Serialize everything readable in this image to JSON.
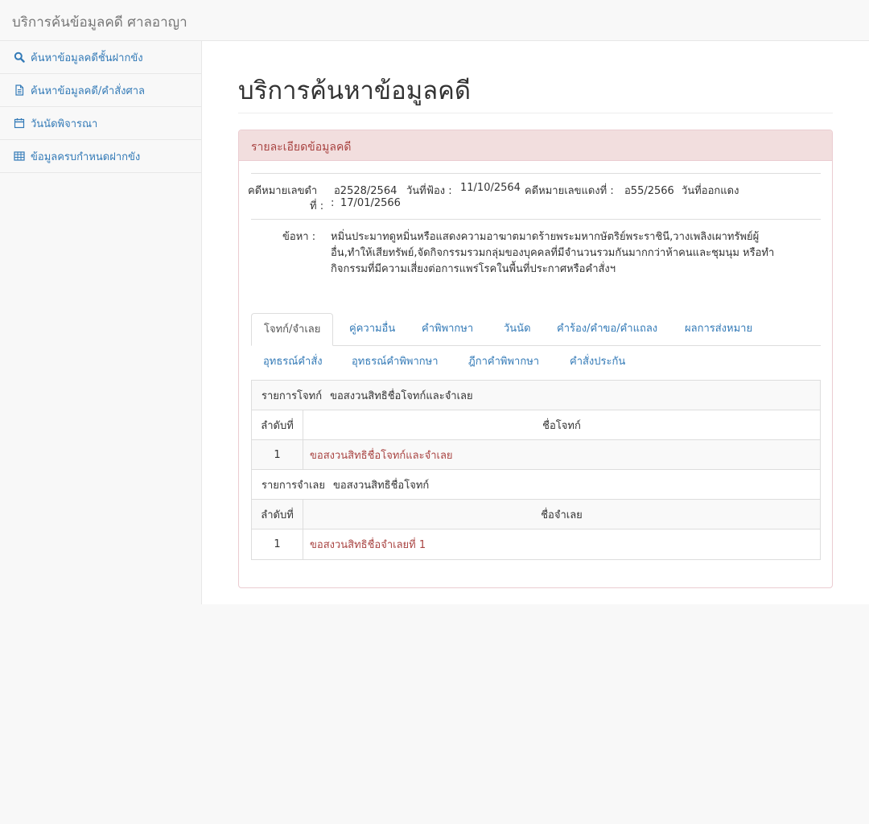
{
  "navbar": {
    "brand": "บริการค้นข้อมูลคดี ศาลอาญา"
  },
  "sidebar": {
    "items": [
      {
        "label": "ค้นหาข้อมูลคดีชั้นฝากขัง",
        "icon": "search-icon"
      },
      {
        "label": "ค้นหาข้อมูลคดี/คำสั่งศาล",
        "icon": "document-icon"
      },
      {
        "label": "วันนัดพิจารณา",
        "icon": "calendar-icon"
      },
      {
        "label": "ข้อมูลครบกำหนดฝากขัง",
        "icon": "table-icon"
      }
    ]
  },
  "main": {
    "title": "บริการค้นหาข้อมูลคดี"
  },
  "panel": {
    "heading": "รายละเอียดข้อมูลคดี",
    "black_case_label_1": "คดีหมายเลขดำ",
    "black_case_label_2": "ที่ :",
    "black_case_value": "อ2528/2564",
    "filed_label": "วันที่ฟ้อง :",
    "filed_value": "11/10/2564",
    "red_case_label": "คดีหมายเลขแดงที่ :",
    "red_case_value": "อ55/2566",
    "red_date_label": "วันที่ออกแดง",
    "red_date_colon": ":",
    "red_date_value": "17/01/2566",
    "charge_label": "ข้อหา :",
    "charge_line1": "หมิ่นประมาทดูหมิ่นหรือแสดงความอาฆาตมาดร้ายพระมหากษัตริย์พระราชินี,วางเพลิงเผาทรัพย์ผู้",
    "charge_line2": "อื่น,ทำให้เสียทรัพย์,จัดกิจกรรมรวมกลุ่มของบุคคลที่มีจำนวนรวมกันมากกว่าห้าคนและชุมนุม หรือทำ",
    "charge_line3": "กิจกรรมที่มีความเสี่ยงต่อการแพร่โรคในพื้นที่ประกาศหรือคำสั่งฯ"
  },
  "tabs": [
    {
      "label": "โจทก์/จำเลย",
      "active": true
    },
    {
      "label": "คู่ความอื่น"
    },
    {
      "label": "คำพิพากษา"
    },
    {
      "label": "วันนัด"
    },
    {
      "label": "คำร้อง/คำขอ/คำแถลง"
    },
    {
      "label": "ผลการส่งหมาย"
    },
    {
      "label": "อุทธรณ์คำสั่ง"
    },
    {
      "label": "อุทธรณ์คำพิพากษา"
    },
    {
      "label": "ฎีกาคำพิพากษา"
    },
    {
      "label": "คำสั่งประกัน"
    }
  ],
  "plaintiff_section": {
    "title": "รายการโจทก์",
    "note": "ขอสงวนสิทธิชื่อโจทก์และจำเลย",
    "col_no": "ลำดับที่",
    "col_name": "ชื่อโจทก์",
    "rows": [
      {
        "no": "1",
        "name": "ขอสงวนสิทธิชื่อโจทก์และจำเลย"
      }
    ]
  },
  "defendant_section": {
    "title": "รายการจำเลย",
    "note": "ขอสงวนสิทธิชื่อโจทก์",
    "col_no": "ลำดับที่",
    "col_name": "ชื่อจำเลย",
    "rows": [
      {
        "no": "1",
        "name": "ขอสงวนสิทธิชื่อจำเลยที่ 1"
      }
    ]
  }
}
